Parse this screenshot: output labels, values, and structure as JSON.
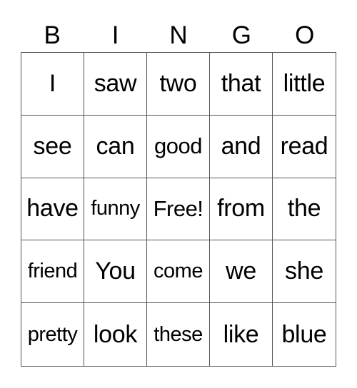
{
  "header": [
    "B",
    "I",
    "N",
    "G",
    "O"
  ],
  "rows": [
    [
      "I",
      "saw",
      "two",
      "that",
      "little"
    ],
    [
      "see",
      "can",
      "good",
      "and",
      "read"
    ],
    [
      "have",
      "funny",
      "Free!",
      "from",
      "the"
    ],
    [
      "friend",
      "You",
      "come",
      "we",
      "she"
    ],
    [
      "pretty",
      "look",
      "these",
      "like",
      "blue"
    ]
  ]
}
